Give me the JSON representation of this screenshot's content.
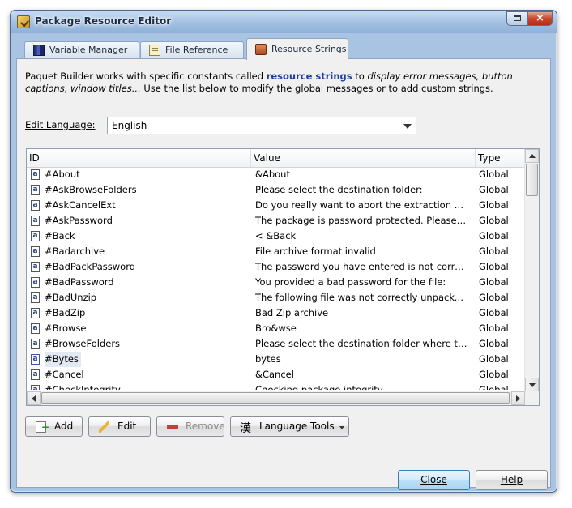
{
  "window": {
    "title": "Package Resource Editor",
    "close_glyph": "×"
  },
  "tabs": [
    {
      "label": "Variable Manager",
      "icon": "film-icon",
      "active": false
    },
    {
      "label": "File Reference",
      "icon": "document-icon",
      "active": false
    },
    {
      "label": "Resource Strings",
      "icon": "package-icon",
      "active": true
    }
  ],
  "description": {
    "p1": "Paquet Builder works with specific constants called ",
    "highlight": "resource strings",
    "p2": " to ",
    "italic1": "display error messages, button captions, window titles...",
    "p3": " Use the list below to modify the global messages or to add custom strings."
  },
  "language": {
    "label": "Edit Language:",
    "value": "English"
  },
  "list": {
    "columns": [
      "ID",
      "Value",
      "Type"
    ],
    "rows": [
      {
        "id": "#About",
        "value": "&About",
        "type": "Global"
      },
      {
        "id": "#AskBrowseFolders",
        "value": "Please select the destination folder:",
        "type": "Global"
      },
      {
        "id": "#AskCancelExt",
        "value": "Do you really want to abort the extraction proce...",
        "type": "Global"
      },
      {
        "id": "#AskPassword",
        "value": "The package is password protected. Please provi...",
        "type": "Global"
      },
      {
        "id": "#Back",
        "value": "< &Back",
        "type": "Global"
      },
      {
        "id": "#Badarchive",
        "value": "File archive format invalid",
        "type": "Global"
      },
      {
        "id": "#BadPackPassword",
        "value": "The password you have entered is not correct, t...",
        "type": "Global"
      },
      {
        "id": "#BadPassword",
        "value": "You provided a bad password for the file:",
        "type": "Global"
      },
      {
        "id": "#BadUnzip",
        "value": "The following file was not correctly unpacked:",
        "type": "Global"
      },
      {
        "id": "#BadZip",
        "value": "Bad Zip archive",
        "type": "Global"
      },
      {
        "id": "#Browse",
        "value": "Bro&wse",
        "type": "Global"
      },
      {
        "id": "#BrowseFolders",
        "value": "Please select the destination folder where the pa...",
        "type": "Global"
      },
      {
        "id": "#Bytes",
        "value": "bytes",
        "type": "Global"
      },
      {
        "id": "#Cancel",
        "value": "&Cancel",
        "type": "Global"
      },
      {
        "id": "#CheckIntegrity",
        "value": "Checking package integrity...",
        "type": "Global"
      }
    ],
    "row_icon_glyph": "a",
    "selected_index": 12
  },
  "buttons": {
    "add": "Add",
    "edit": "Edit",
    "remove": "Remove",
    "language_tools": "Language Tools",
    "language_tools_glyph": "漢",
    "close": "Close",
    "help": "Help"
  }
}
